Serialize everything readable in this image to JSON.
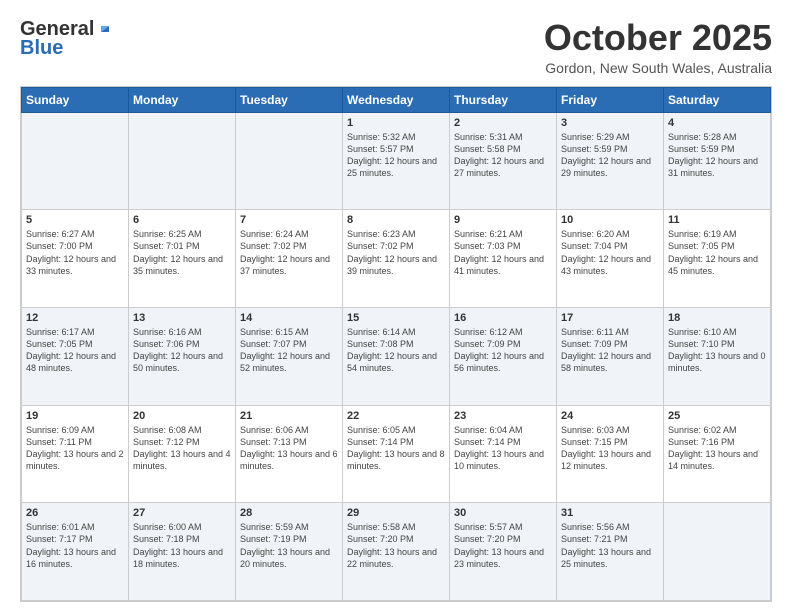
{
  "header": {
    "logo_general": "General",
    "logo_blue": "Blue",
    "month_title": "October 2025",
    "location": "Gordon, New South Wales, Australia"
  },
  "days_of_week": [
    "Sunday",
    "Monday",
    "Tuesday",
    "Wednesday",
    "Thursday",
    "Friday",
    "Saturday"
  ],
  "weeks": [
    [
      {
        "day": "",
        "info": ""
      },
      {
        "day": "",
        "info": ""
      },
      {
        "day": "",
        "info": ""
      },
      {
        "day": "1",
        "info": "Sunrise: 5:32 AM\nSunset: 5:57 PM\nDaylight: 12 hours\nand 25 minutes."
      },
      {
        "day": "2",
        "info": "Sunrise: 5:31 AM\nSunset: 5:58 PM\nDaylight: 12 hours\nand 27 minutes."
      },
      {
        "day": "3",
        "info": "Sunrise: 5:29 AM\nSunset: 5:59 PM\nDaylight: 12 hours\nand 29 minutes."
      },
      {
        "day": "4",
        "info": "Sunrise: 5:28 AM\nSunset: 5:59 PM\nDaylight: 12 hours\nand 31 minutes."
      }
    ],
    [
      {
        "day": "5",
        "info": "Sunrise: 6:27 AM\nSunset: 7:00 PM\nDaylight: 12 hours\nand 33 minutes."
      },
      {
        "day": "6",
        "info": "Sunrise: 6:25 AM\nSunset: 7:01 PM\nDaylight: 12 hours\nand 35 minutes."
      },
      {
        "day": "7",
        "info": "Sunrise: 6:24 AM\nSunset: 7:02 PM\nDaylight: 12 hours\nand 37 minutes."
      },
      {
        "day": "8",
        "info": "Sunrise: 6:23 AM\nSunset: 7:02 PM\nDaylight: 12 hours\nand 39 minutes."
      },
      {
        "day": "9",
        "info": "Sunrise: 6:21 AM\nSunset: 7:03 PM\nDaylight: 12 hours\nand 41 minutes."
      },
      {
        "day": "10",
        "info": "Sunrise: 6:20 AM\nSunset: 7:04 PM\nDaylight: 12 hours\nand 43 minutes."
      },
      {
        "day": "11",
        "info": "Sunrise: 6:19 AM\nSunset: 7:05 PM\nDaylight: 12 hours\nand 45 minutes."
      }
    ],
    [
      {
        "day": "12",
        "info": "Sunrise: 6:17 AM\nSunset: 7:05 PM\nDaylight: 12 hours\nand 48 minutes."
      },
      {
        "day": "13",
        "info": "Sunrise: 6:16 AM\nSunset: 7:06 PM\nDaylight: 12 hours\nand 50 minutes."
      },
      {
        "day": "14",
        "info": "Sunrise: 6:15 AM\nSunset: 7:07 PM\nDaylight: 12 hours\nand 52 minutes."
      },
      {
        "day": "15",
        "info": "Sunrise: 6:14 AM\nSunset: 7:08 PM\nDaylight: 12 hours\nand 54 minutes."
      },
      {
        "day": "16",
        "info": "Sunrise: 6:12 AM\nSunset: 7:09 PM\nDaylight: 12 hours\nand 56 minutes."
      },
      {
        "day": "17",
        "info": "Sunrise: 6:11 AM\nSunset: 7:09 PM\nDaylight: 12 hours\nand 58 minutes."
      },
      {
        "day": "18",
        "info": "Sunrise: 6:10 AM\nSunset: 7:10 PM\nDaylight: 13 hours\nand 0 minutes."
      }
    ],
    [
      {
        "day": "19",
        "info": "Sunrise: 6:09 AM\nSunset: 7:11 PM\nDaylight: 13 hours\nand 2 minutes."
      },
      {
        "day": "20",
        "info": "Sunrise: 6:08 AM\nSunset: 7:12 PM\nDaylight: 13 hours\nand 4 minutes."
      },
      {
        "day": "21",
        "info": "Sunrise: 6:06 AM\nSunset: 7:13 PM\nDaylight: 13 hours\nand 6 minutes."
      },
      {
        "day": "22",
        "info": "Sunrise: 6:05 AM\nSunset: 7:14 PM\nDaylight: 13 hours\nand 8 minutes."
      },
      {
        "day": "23",
        "info": "Sunrise: 6:04 AM\nSunset: 7:14 PM\nDaylight: 13 hours\nand 10 minutes."
      },
      {
        "day": "24",
        "info": "Sunrise: 6:03 AM\nSunset: 7:15 PM\nDaylight: 13 hours\nand 12 minutes."
      },
      {
        "day": "25",
        "info": "Sunrise: 6:02 AM\nSunset: 7:16 PM\nDaylight: 13 hours\nand 14 minutes."
      }
    ],
    [
      {
        "day": "26",
        "info": "Sunrise: 6:01 AM\nSunset: 7:17 PM\nDaylight: 13 hours\nand 16 minutes."
      },
      {
        "day": "27",
        "info": "Sunrise: 6:00 AM\nSunset: 7:18 PM\nDaylight: 13 hours\nand 18 minutes."
      },
      {
        "day": "28",
        "info": "Sunrise: 5:59 AM\nSunset: 7:19 PM\nDaylight: 13 hours\nand 20 minutes."
      },
      {
        "day": "29",
        "info": "Sunrise: 5:58 AM\nSunset: 7:20 PM\nDaylight: 13 hours\nand 22 minutes."
      },
      {
        "day": "30",
        "info": "Sunrise: 5:57 AM\nSunset: 7:20 PM\nDaylight: 13 hours\nand 23 minutes."
      },
      {
        "day": "31",
        "info": "Sunrise: 5:56 AM\nSunset: 7:21 PM\nDaylight: 13 hours\nand 25 minutes."
      },
      {
        "day": "",
        "info": ""
      }
    ]
  ]
}
